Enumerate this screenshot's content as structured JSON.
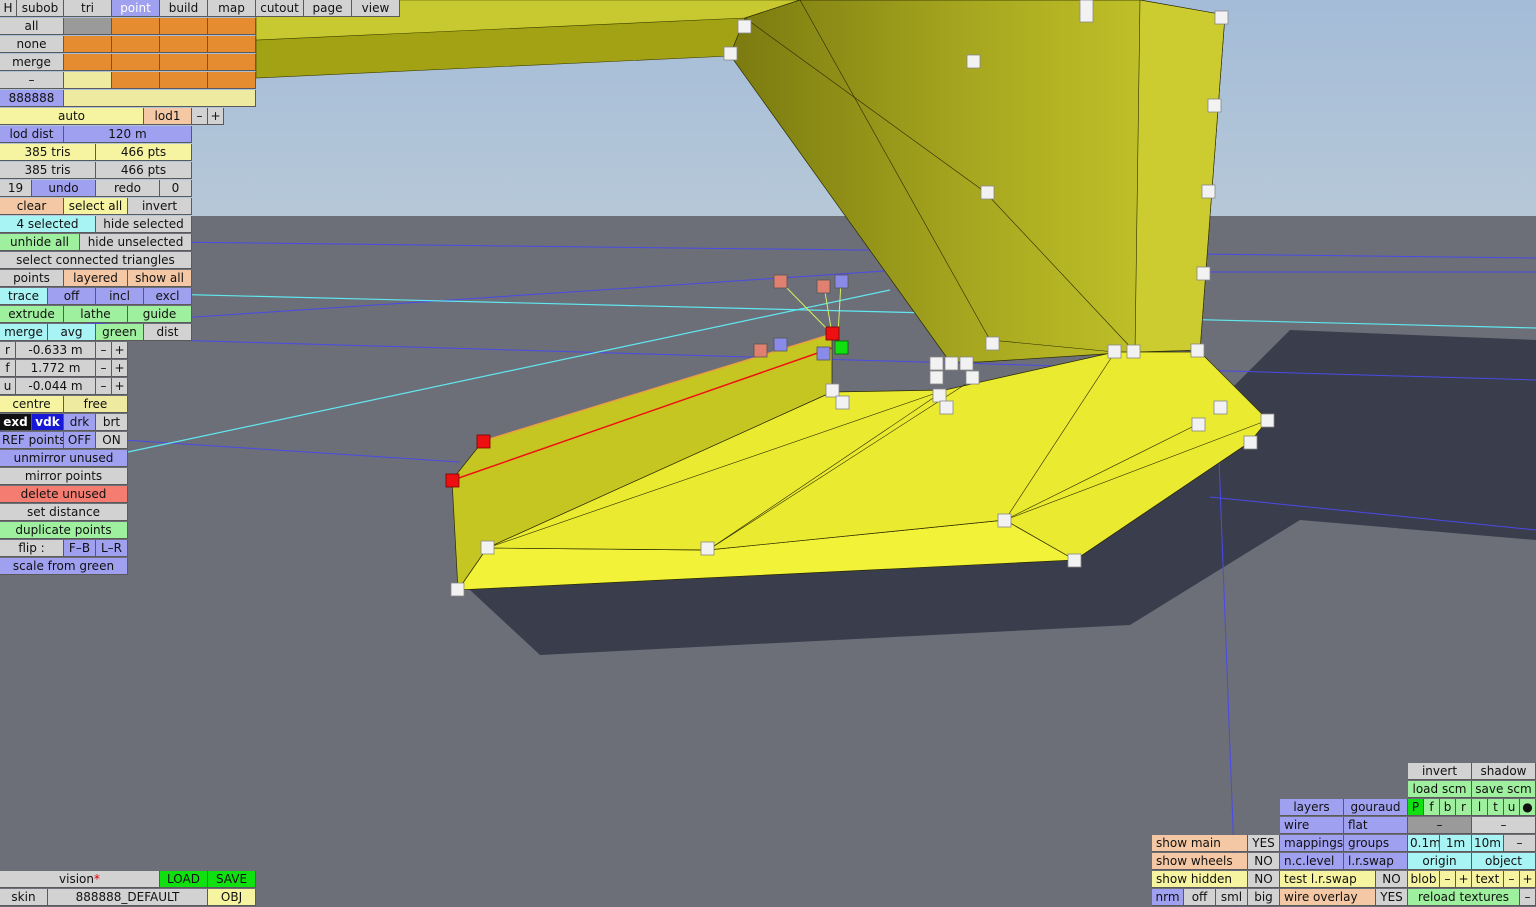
{
  "scene": {
    "sky_color": "#a6c2da",
    "ground_color": "#6c6e78",
    "shadow_color": "#3a3d4c",
    "model_color": "#e2e240",
    "selected_point_color": "#ee1010",
    "green_point_color": "#10e010",
    "reference_line_color": "#4a4ae8",
    "cyan_line_color": "#60e8f0"
  },
  "top_menu": {
    "h": "H",
    "items": [
      "subob",
      "tri",
      "point",
      "build",
      "map",
      "cutout",
      "page",
      "view"
    ],
    "active": "point"
  },
  "layers": {
    "all": "all",
    "none": "none",
    "merge": "merge",
    "dash": "–",
    "id": "888888"
  },
  "lod": {
    "auto": "auto",
    "lod1": "lod1",
    "minus": "–",
    "plus": "+",
    "dist_label": "lod dist",
    "dist_value": "120 m"
  },
  "stats": {
    "tris1": "385 tris",
    "pts1": "466 pts",
    "tris2": "385 tris",
    "pts2": "466 pts"
  },
  "history": {
    "count": "19",
    "undo": "undo",
    "redo": "redo",
    "redo_count": "0"
  },
  "selection": {
    "clear": "clear",
    "select_all": "select all",
    "invert": "invert",
    "selected": "4 selected",
    "hide_selected": "hide selected",
    "unhide_all": "unhide all",
    "hide_unselected": "hide unselected",
    "select_connected": "select connected triangles"
  },
  "points_mode": {
    "points": "points",
    "layered": "layered",
    "show_all": "show all"
  },
  "trace": {
    "trace": "trace",
    "off": "off",
    "incl": "incl",
    "excl": "excl"
  },
  "tools": {
    "extrude": "extrude",
    "lathe": "lathe",
    "guide": "guide"
  },
  "merge_row": {
    "merge": "merge",
    "avg": "avg",
    "green": "green",
    "dist": "dist"
  },
  "coords": {
    "r_label": "r",
    "r_value": "-0.633 m",
    "f_label": "f",
    "f_value": "1.772 m",
    "u_label": "u",
    "u_value": "-0.044 m",
    "minus": "–",
    "plus": "+"
  },
  "pivot": {
    "centre": "centre",
    "free": "free"
  },
  "display": {
    "exd": "exd",
    "vdk": "vdk",
    "drk": "drk",
    "brt": "brt"
  },
  "ref_points": {
    "label": "REF points",
    "off": "OFF",
    "on": "ON"
  },
  "actions": {
    "unmirror_unused": "unmirror unused",
    "mirror_points": "mirror points",
    "delete_unused": "delete unused",
    "set_distance": "set distance",
    "duplicate_points": "duplicate points",
    "flip_label": "flip :",
    "flip_fb": "F–B",
    "flip_lr": "L–R",
    "scale_from_green": "scale from green"
  },
  "bottom_left": {
    "vision": "vision",
    "vision_mark": "*",
    "load": "LOAD",
    "save": "SAVE",
    "skin": "skin",
    "skin_name": "888888_DEFAULT",
    "obj": "OBJ"
  },
  "bottom_right": {
    "invert": "invert",
    "shadow": "shadow",
    "load_scm": "load scm",
    "save_scm": "save scm",
    "flags": [
      "P",
      "f",
      "b",
      "r",
      "l",
      "t",
      "u",
      "●"
    ],
    "layers": "layers",
    "gouraud": "gouraud",
    "wire": "wire",
    "flat": "flat",
    "dash": "–",
    "show_main": "show main",
    "show_main_val": "YES",
    "mappings": "mappings",
    "groups": "groups",
    "step1": "0.1m",
    "step2": "1m",
    "step3": "10m",
    "show_wheels": "show wheels",
    "show_wheels_val": "NO",
    "nc_level": "n.c.level",
    "lr_swap": "l.r.swap",
    "origin": "origin",
    "object": "object",
    "show_hidden": "show hidden",
    "show_hidden_val": "NO",
    "test_lr_swap": "test l.r.swap",
    "test_lr_swap_val": "NO",
    "blob": "blob",
    "text": "text",
    "minus": "–",
    "plus": "+",
    "nrm": "nrm",
    "off": "off",
    "sml": "sml",
    "big": "big",
    "wire_overlay": "wire overlay",
    "wire_overlay_val": "YES",
    "reload_textures": "reload textures"
  }
}
